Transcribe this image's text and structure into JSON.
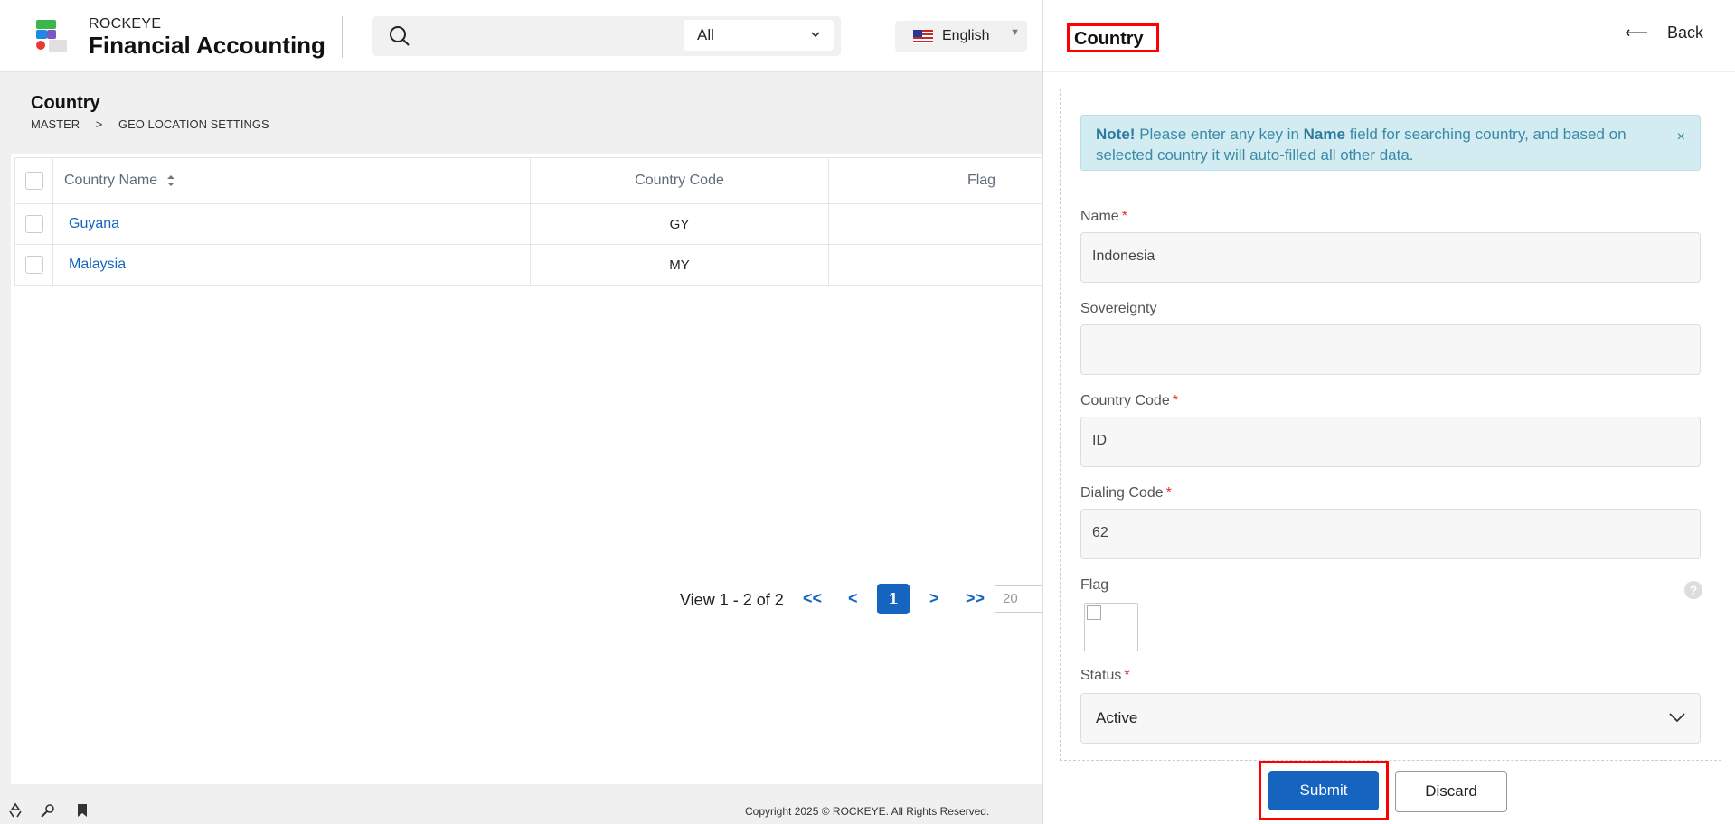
{
  "header": {
    "brand_small": "ROCKEYE",
    "brand_big": "Financial Accounting",
    "search_placeholder": "",
    "search_filter": "All",
    "language": "English"
  },
  "page": {
    "title": "Country",
    "breadcrumb": [
      "MASTER",
      ">",
      "GEO LOCATION SETTINGS"
    ]
  },
  "table": {
    "columns": [
      "Country Name",
      "Country Code",
      "Flag"
    ],
    "rows": [
      {
        "name": "Guyana",
        "code": "GY"
      },
      {
        "name": "Malaysia",
        "code": "MY"
      }
    ]
  },
  "pagination": {
    "view_text": "View 1 - 2 of 2",
    "first": "<<",
    "prev": "<",
    "current": "1",
    "next": ">",
    "last": ">>",
    "page_size": "20"
  },
  "footer": {
    "copyright": "Copyright 2025 © ROCKEYE. All Rights Reserved."
  },
  "panel": {
    "title": "Country",
    "back_label": "Back",
    "note_bold": "Note!",
    "note_text_1": "Please enter any key in",
    "note_field": "Name",
    "note_text_2": "field for searching country, and based on selected country it will auto-filled all other data.",
    "note_close": "×",
    "fields": {
      "name_label": "Name",
      "name_value": "Indonesia",
      "sovereignty_label": "Sovereignty",
      "sovereignty_value": "",
      "country_code_label": "Country Code",
      "country_code_value": "ID",
      "dialing_code_label": "Dialing Code",
      "dialing_code_value": "62",
      "flag_label": "Flag",
      "status_label": "Status",
      "status_value": "Active"
    },
    "required_mark": "*",
    "help": "?",
    "submit_label": "Submit",
    "discard_label": "Discard"
  },
  "colors": {
    "primary": "#1565c0",
    "highlight_box": "#ff0000",
    "note_bg": "#d2ecf2"
  }
}
